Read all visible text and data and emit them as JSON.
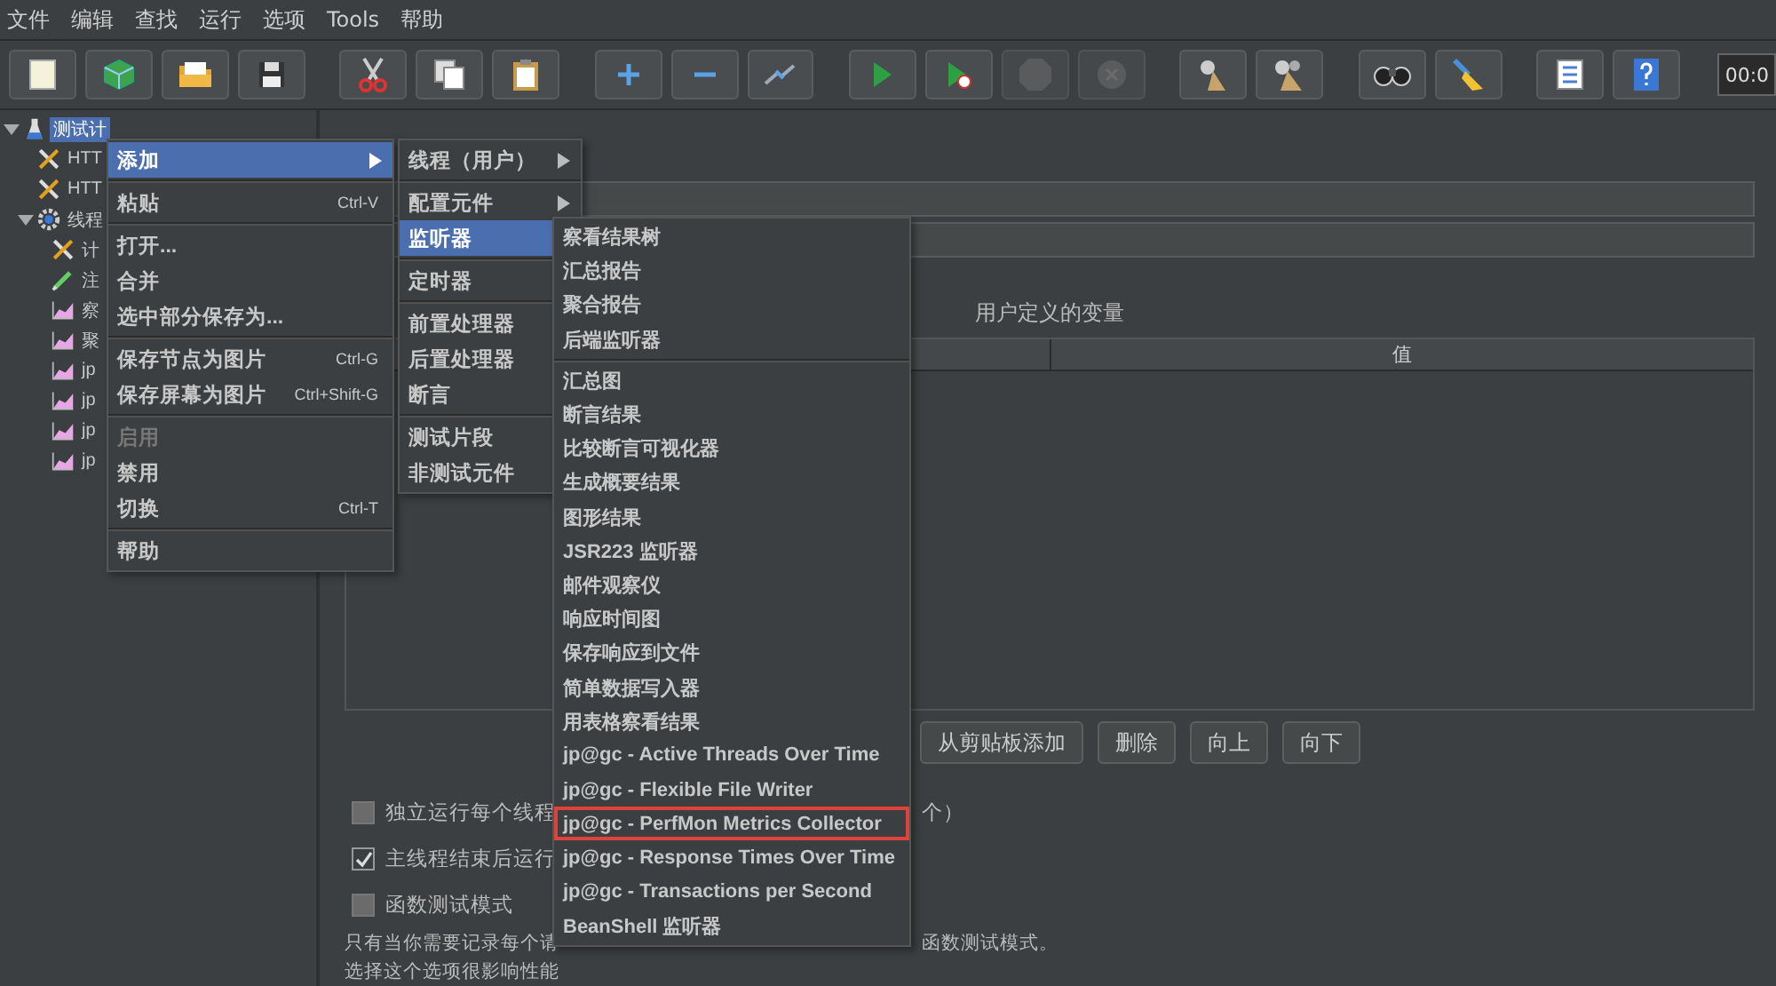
{
  "menu_bar": [
    "文件",
    "编辑",
    "查找",
    "运行",
    "选项",
    "Tools",
    "帮助"
  ],
  "toolbar": {
    "buttons": [
      {
        "kind": "new",
        "disabled": false
      },
      {
        "kind": "templates",
        "disabled": false
      },
      {
        "kind": "open",
        "disabled": false
      },
      {
        "kind": "save",
        "disabled": false
      },
      {
        "kind": "cut",
        "disabled": false
      },
      {
        "kind": "copy",
        "disabled": false
      },
      {
        "kind": "paste",
        "disabled": false
      },
      {
        "kind": "expand",
        "disabled": false
      },
      {
        "kind": "collapse",
        "disabled": false
      },
      {
        "kind": "toggle",
        "disabled": false
      },
      {
        "kind": "start",
        "disabled": false
      },
      {
        "kind": "start-no-pause",
        "disabled": false
      },
      {
        "kind": "stop",
        "disabled": true
      },
      {
        "kind": "shutdown",
        "disabled": true
      },
      {
        "kind": "clear",
        "disabled": false
      },
      {
        "kind": "clear-all",
        "disabled": false
      },
      {
        "kind": "search",
        "disabled": false
      },
      {
        "kind": "reset-search",
        "disabled": false
      },
      {
        "kind": "function-helper",
        "disabled": false
      },
      {
        "kind": "help",
        "disabled": false
      }
    ],
    "timer": "00:0"
  },
  "tree": [
    {
      "label": "测试计",
      "kind": "plan",
      "selected": true,
      "expanded": true,
      "children": [
        {
          "label": "HTT",
          "kind": "tool",
          "selected": false
        },
        {
          "label": "HTT",
          "kind": "tool",
          "selected": false
        },
        {
          "label": "线程",
          "kind": "thread-group",
          "selected": false,
          "expanded": true,
          "children": [
            {
              "label": "计",
              "kind": "tool",
              "selected": false
            },
            {
              "label": "注",
              "kind": "pen",
              "selected": false
            },
            {
              "label": "察",
              "kind": "graph",
              "selected": false
            },
            {
              "label": "聚",
              "kind": "graph",
              "selected": false
            },
            {
              "label": "jp",
              "kind": "graph",
              "selected": false
            },
            {
              "label": "jp",
              "kind": "graph",
              "selected": false
            },
            {
              "label": "jp",
              "kind": "graph",
              "selected": false
            },
            {
              "label": "jp",
              "kind": "graph",
              "selected": false
            }
          ]
        }
      ]
    }
  ],
  "panel": {
    "variables_title": "用户定义的变量",
    "table": {
      "columns": [
        "值"
      ]
    },
    "buttons": [
      "从剪贴板添加",
      "删除",
      "向上",
      "向下"
    ],
    "options": [
      {
        "label": "独立运行每个线程",
        "tail": "个）",
        "checked": false
      },
      {
        "label": "主线程结束后运行",
        "checked": true
      },
      {
        "label": "函数测试模式",
        "checked": false
      }
    ],
    "description": [
      {
        "text": "只有当你需要记录每个请",
        "tail": "函数测试模式。"
      },
      {
        "text": "选择这个选项很影响性能"
      }
    ]
  },
  "context_menu": [
    {
      "kind": "item",
      "label": "添加",
      "submenu": true,
      "selected": true,
      "disabled": false
    },
    {
      "kind": "separator"
    },
    {
      "kind": "item",
      "label": "粘贴",
      "shortcut": "Ctrl-V",
      "submenu": false,
      "selected": false,
      "disabled": false
    },
    {
      "kind": "separator"
    },
    {
      "kind": "item",
      "label": "打开...",
      "submenu": false,
      "selected": false,
      "disabled": false
    },
    {
      "kind": "item",
      "label": "合并",
      "submenu": false,
      "selected": false,
      "disabled": false
    },
    {
      "kind": "item",
      "label": "选中部分保存为...",
      "submenu": false,
      "selected": false,
      "disabled": false
    },
    {
      "kind": "separator"
    },
    {
      "kind": "item",
      "label": "保存节点为图片",
      "shortcut": "Ctrl-G",
      "submenu": false,
      "selected": false,
      "disabled": false
    },
    {
      "kind": "item",
      "label": "保存屏幕为图片",
      "shortcut": "Ctrl+Shift-G",
      "submenu": false,
      "selected": false,
      "disabled": false
    },
    {
      "kind": "separator"
    },
    {
      "kind": "item",
      "label": "启用",
      "submenu": false,
      "selected": false,
      "disabled": true
    },
    {
      "kind": "item",
      "label": "禁用",
      "submenu": false,
      "selected": false,
      "disabled": false
    },
    {
      "kind": "item",
      "label": "切换",
      "shortcut": "Ctrl-T",
      "submenu": false,
      "selected": false,
      "disabled": false
    },
    {
      "kind": "separator"
    },
    {
      "kind": "item",
      "label": "帮助",
      "submenu": false,
      "selected": false,
      "disabled": false
    }
  ],
  "add_submenu": [
    {
      "kind": "item",
      "label": "线程（用户）",
      "submenu": true,
      "selected": false,
      "disabled": false
    },
    {
      "kind": "separator"
    },
    {
      "kind": "item",
      "label": "配置元件",
      "submenu": true,
      "selected": false,
      "disabled": false
    },
    {
      "kind": "item",
      "label": "监听器",
      "submenu": true,
      "selected": true,
      "disabled": false
    },
    {
      "kind": "separator"
    },
    {
      "kind": "item",
      "label": "定时器",
      "submenu": true,
      "selected": false,
      "disabled": false
    },
    {
      "kind": "separator"
    },
    {
      "kind": "item",
      "label": "前置处理器",
      "submenu": true,
      "selected": false,
      "disabled": false
    },
    {
      "kind": "item",
      "label": "后置处理器",
      "submenu": true,
      "selected": false,
      "disabled": false
    },
    {
      "kind": "item",
      "label": "断言",
      "submenu": true,
      "selected": false,
      "disabled": false
    },
    {
      "kind": "separator"
    },
    {
      "kind": "item",
      "label": "测试片段",
      "submenu": true,
      "selected": false,
      "disabled": false
    },
    {
      "kind": "item",
      "label": "非测试元件",
      "submenu": true,
      "selected": false,
      "disabled": false
    }
  ],
  "listener_submenu": [
    {
      "kind": "item",
      "label": "察看结果树",
      "outlined": false
    },
    {
      "kind": "item",
      "label": "汇总报告",
      "outlined": false
    },
    {
      "kind": "item",
      "label": "聚合报告",
      "outlined": false
    },
    {
      "kind": "item",
      "label": "后端监听器",
      "outlined": false
    },
    {
      "kind": "separator"
    },
    {
      "kind": "item",
      "label": "汇总图",
      "outlined": false
    },
    {
      "kind": "item",
      "label": "断言结果",
      "outlined": false
    },
    {
      "kind": "item",
      "label": "比较断言可视化器",
      "outlined": false
    },
    {
      "kind": "item",
      "label": "生成概要结果",
      "outlined": false
    },
    {
      "kind": "item",
      "label": "图形结果",
      "outlined": false
    },
    {
      "kind": "item",
      "label": "JSR223 监听器",
      "outlined": false
    },
    {
      "kind": "item",
      "label": "邮件观察仪",
      "outlined": false
    },
    {
      "kind": "item",
      "label": "响应时间图",
      "outlined": false
    },
    {
      "kind": "item",
      "label": "保存响应到文件",
      "outlined": false
    },
    {
      "kind": "item",
      "label": "简单数据写入器",
      "outlined": false
    },
    {
      "kind": "item",
      "label": "用表格察看结果",
      "outlined": false
    },
    {
      "kind": "item",
      "label": "jp@gc - Active Threads Over Time",
      "outlined": false
    },
    {
      "kind": "item",
      "label": "jp@gc - Flexible File Writer",
      "outlined": false
    },
    {
      "kind": "item",
      "label": "jp@gc - PerfMon Metrics Collector",
      "outlined": true
    },
    {
      "kind": "item",
      "label": "jp@gc - Response Times Over Time",
      "outlined": false
    },
    {
      "kind": "item",
      "label": "jp@gc - Transactions per Second",
      "outlined": false
    },
    {
      "kind": "item",
      "label": "BeanShell 监听器",
      "outlined": false
    }
  ]
}
